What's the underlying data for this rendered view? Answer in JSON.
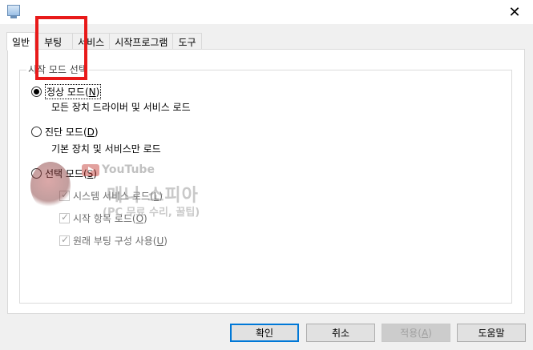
{
  "tabs": [
    {
      "label": "일반",
      "active": true
    },
    {
      "label": "부팅",
      "active": false
    },
    {
      "label": "서비스",
      "active": false
    },
    {
      "label": "시작프로그램",
      "active": false
    },
    {
      "label": "도구",
      "active": false
    }
  ],
  "group": {
    "legend": "시작 모드 선택"
  },
  "options": {
    "normal": {
      "label": "정상 모드",
      "mnemonic": "N",
      "desc": "모든 장치 드라이버 및 서비스 로드",
      "selected": true
    },
    "diagnostic": {
      "label": "진단 모드",
      "mnemonic": "D",
      "desc": "기본 장치 및 서비스만 로드",
      "selected": false
    },
    "selective": {
      "label": "선택 모드",
      "mnemonic": "S",
      "selected": false
    }
  },
  "checks": {
    "system_services": {
      "label": "시스템 서비스 로드",
      "mnemonic": "L",
      "checked": true
    },
    "startup_items": {
      "label": "시작 항목 로드",
      "mnemonic": "O",
      "checked": true
    },
    "original_boot": {
      "label": "원래 부팅 구성 사용",
      "mnemonic": "U",
      "checked": true
    }
  },
  "watermark": {
    "platform": "YouTube",
    "channel": "매니 소피아",
    "subtitle": "(PC 무료 수리, 꿀팁)"
  },
  "buttons": {
    "ok": "확인",
    "cancel": "취소",
    "apply": "적용",
    "apply_mnemonic": "A",
    "help": "도움말"
  },
  "colors": {
    "highlight": "#e81a1a",
    "accent": "#0078d7"
  },
  "icons": {
    "close": "close-icon",
    "app": "msconfig-app-icon"
  }
}
